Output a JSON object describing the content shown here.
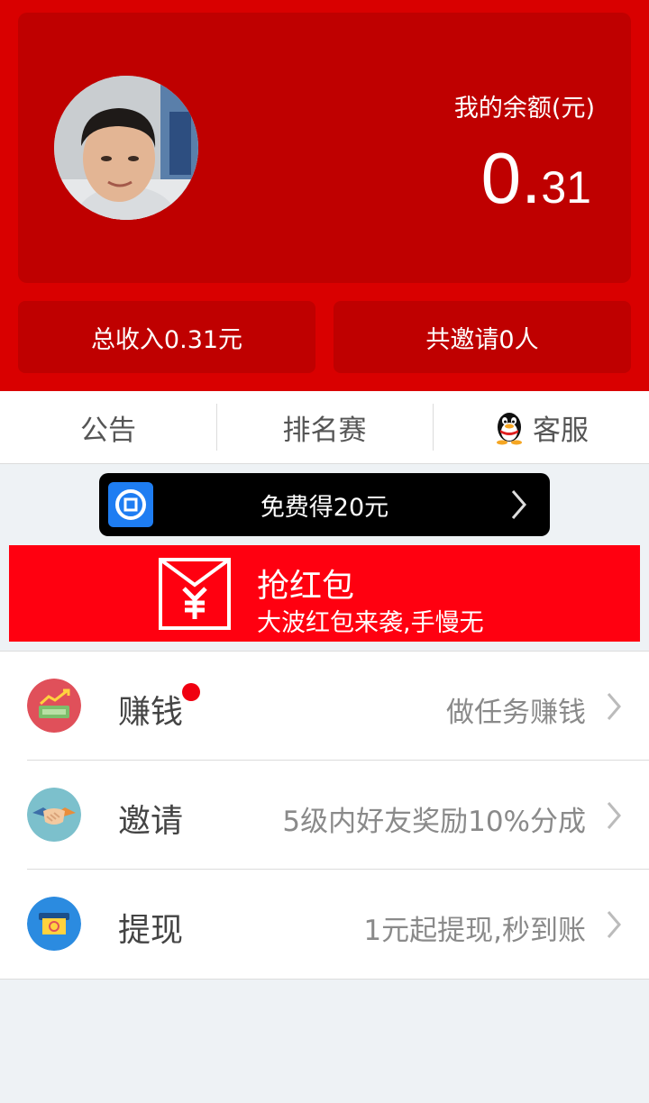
{
  "account": {
    "balance_label": "我的余额(元)",
    "balance_int": "0.",
    "balance_frac": "31",
    "total_income": "总收入0.31元",
    "invited": "共邀请0人"
  },
  "tabs": [
    {
      "label": "公告"
    },
    {
      "label": "排名赛"
    },
    {
      "label": "客服",
      "icon": "qq-penguin-icon"
    }
  ],
  "promo": {
    "text": "免费得20元",
    "icon": "coin-icon"
  },
  "red_packet": {
    "title": "抢红包",
    "subtitle": "大波红包来袭,手慢无",
    "icon": "red-envelope-yuan-icon"
  },
  "menu": [
    {
      "label": "赚钱",
      "desc": "做任务赚钱",
      "icon": "money-chart-icon",
      "color": "#e0505a",
      "badge": true
    },
    {
      "label": "邀请",
      "desc": "5级内好友奖励10%分成",
      "icon": "handshake-icon",
      "color": "#7cc0cc",
      "badge": false
    },
    {
      "label": "提现",
      "desc": "1元起提现,秒到账",
      "icon": "withdraw-atm-icon",
      "color": "#2b8be0",
      "badge": false
    }
  ],
  "colors": {
    "header_red": "#d90000",
    "card_red": "#bf0000",
    "packet_red": "#ff0010"
  }
}
